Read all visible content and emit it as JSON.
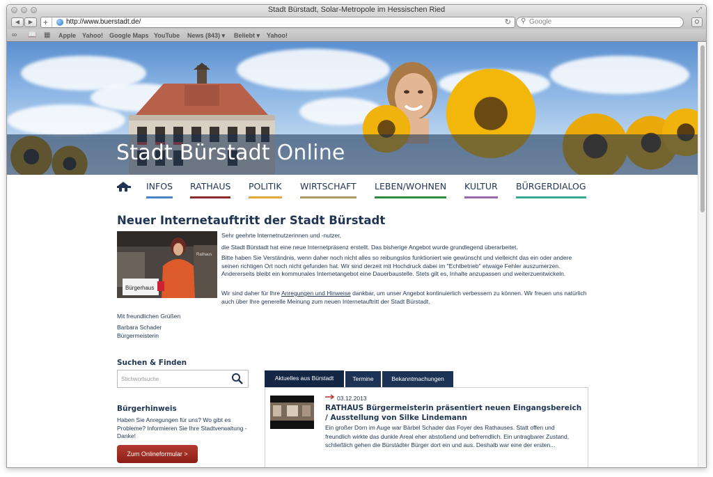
{
  "browser": {
    "window_title": "Stadt Bürstadt, Solar-Metropole im Hessischen Ried",
    "url": "http://www.buerstadt.de/",
    "search_placeholder": "Google",
    "bookmarks": [
      "Apple",
      "Yahoo!",
      "Google Maps",
      "YouTube",
      "News (843) ▾",
      "Beliebt ▾",
      "Yahoo!"
    ]
  },
  "header": {
    "site_title_bold": "Stadt Bürstadt",
    "site_title_light": "Online"
  },
  "nav": {
    "items": [
      {
        "label": "INFOS",
        "color": "#4a83c6"
      },
      {
        "label": "RATHAUS",
        "color": "#8a2a2a"
      },
      {
        "label": "POLITIK",
        "color": "#e0a93a"
      },
      {
        "label": "WIRTSCHAFT",
        "color": "#a89a6a"
      },
      {
        "label": "LEBEN/WOHNEN",
        "color": "#2e8a3c"
      },
      {
        "label": "KULTUR",
        "color": "#9a6aa8"
      },
      {
        "label": "BÜRGERDIALOG",
        "color": "#3aa895"
      }
    ]
  },
  "article": {
    "title": "Neuer Internetauftritt der Stadt Bürstadt",
    "photo_sign": "Bürgerhaus",
    "photo_sign_wall": "Rathaus",
    "greeting": "Sehr geehrte Internetnutzerinnen und -nutzer,",
    "p1": "die Stadt Bürstadt hat eine neue Internetpräsenz erstellt. Das bisherige Angebot wurde grundlegend überarbeitet.",
    "p2": "Bitte haben Sie Verständnis, wenn daher noch nicht alles so reibungslos funktioniert wie gewünscht und vielleicht das ein oder andere seinen richtigen Ort noch nicht gefunden hat. Wir sind derzeit mit Hochdruck dabei im \"Echtbetrieb\" etwaige Fehler auszumerzen. Andererseits bleibt ein kommunales Internetangebot eine Dauerbaustelle. Stets gilt es, Inhalte anzupassen und weiterzuentwickeln.",
    "p3_before": "Wir sind daher für Ihre ",
    "p3_link": "Anregungen und Hinweise",
    "p3_after": " dankbar, um unser Angebot kontinuierlich verbessern zu können. Wir freuen uns natürlich auch über Ihre generelle Meinung zum neuen Internetauftritt der Stadt Bürstadt.",
    "closing": "Mit freundlichen Grüßen",
    "signer_name": "Barbara Schader",
    "signer_role": "Bürgermeisterin"
  },
  "sidebar": {
    "search_heading": "Suchen & Finden",
    "search_placeholder": "Stichwortsuche",
    "hint_heading": "Bürgerhinweis",
    "hint_text": "Haben Sie Anregungen für uns? Wo gibt es Probleme? Informieren Sie Ihre Stadtverwaltung - Danke!",
    "form_button": "Zum Onlineformular >"
  },
  "news": {
    "tabs": [
      "Aktuelles aus Bürstadt",
      "Termine",
      "Bekanntmachungen"
    ],
    "item": {
      "date": "03.12.2013",
      "headline": "RATHAUS Bürgermeisterin präsentiert neuen Eingangsbereich / Ausstellung von Silke Lindemann",
      "teaser": "Ein großer Dorn im Auge war Bärbel Schader das Foyer des Rathauses. Statt offen und freundlich wirkte das dunkle Areal eher abstoßend und befremdlich. Ein untragbarer Zustand, schließlich gehen die Bürstädter Bürger dort ein und aus. Deshalb war eine der ersten..."
    }
  }
}
